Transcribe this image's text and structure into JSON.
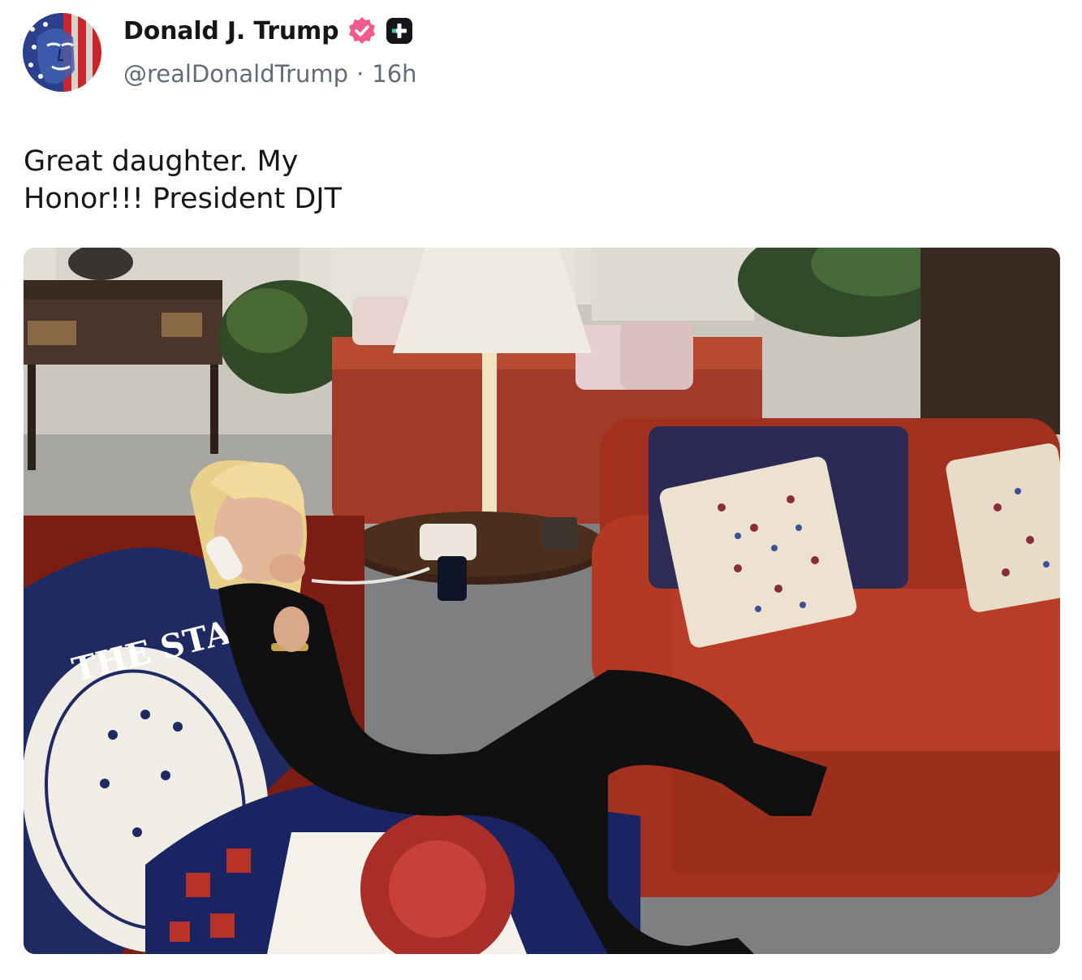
{
  "post": {
    "author": {
      "display_name": "Donald J. Trump",
      "handle": "@realDonaldTrump",
      "separator": "·",
      "time_ago": "16h",
      "avatar_icon": "flag-portrait-avatar",
      "verified_icon": "verified-badge-icon",
      "premium_icon": "plus-badge-icon"
    },
    "text_lines": [
      "Great daughter. My",
      "Honor!!! President DJT"
    ],
    "image": {
      "description_icon": "photo",
      "throw_text": "THE STATE"
    },
    "colors": {
      "verified": "#f25c8b",
      "badge_dark": "#14161a",
      "handle_gray": "#646b78"
    }
  }
}
